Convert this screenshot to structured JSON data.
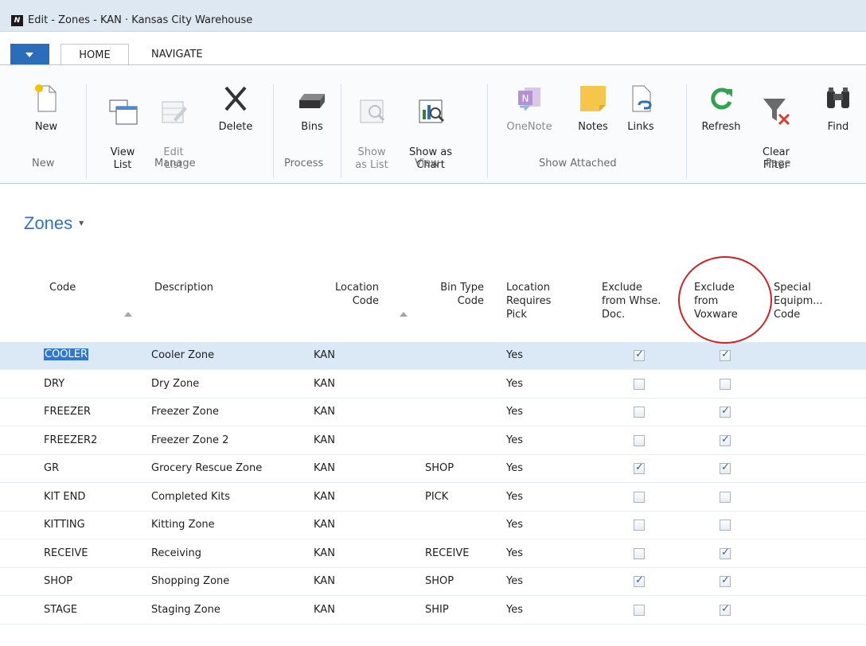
{
  "window": {
    "title": "Edit - Zones - KAN · Kansas City Warehouse",
    "logo": "dynamics-nav-logo"
  },
  "tabs": [
    {
      "label": "HOME",
      "active": true
    },
    {
      "label": "NAVIGATE",
      "active": false
    }
  ],
  "ribbon": {
    "buttons": {
      "new": {
        "label": "New",
        "icon": "new-document-icon"
      },
      "view_list": {
        "label": "View\nList",
        "icon": "view-list-icon"
      },
      "edit_list": {
        "label": "Edit\nList",
        "icon": "edit-list-icon",
        "disabled": true
      },
      "delete": {
        "label": "Delete",
        "icon": "delete-x-icon"
      },
      "bins": {
        "label": "Bins",
        "icon": "bins-icon"
      },
      "show_as_list": {
        "label": "Show\nas List",
        "icon": "show-as-list-icon",
        "disabled": true
      },
      "show_as_chart": {
        "label": "Show as\nChart",
        "icon": "show-as-chart-icon"
      },
      "onenote": {
        "label": "OneNote",
        "icon": "onenote-icon",
        "disabled": true
      },
      "notes": {
        "label": "Notes",
        "icon": "notes-icon"
      },
      "links": {
        "label": "Links",
        "icon": "links-icon"
      },
      "refresh": {
        "label": "Refresh",
        "icon": "refresh-icon"
      },
      "clear_filter": {
        "label": "Clear\nFilter",
        "icon": "clear-filter-icon"
      },
      "find": {
        "label": "Find",
        "icon": "binoculars-icon"
      }
    },
    "groups": {
      "new": "New",
      "manage": "Manage",
      "process": "Process",
      "view": "View",
      "show_attached": "Show Attached",
      "page": "Page"
    }
  },
  "page": {
    "title": "Zones",
    "caret": "▾"
  },
  "table": {
    "columns": {
      "code": "Code",
      "description": "Description",
      "location_code": "Location\nCode",
      "bin_type_code": "Bin Type\nCode",
      "location_requires_pick": "Location\nRequires\nPick",
      "exclude_whse": "Exclude\nfrom Whse.\nDoc.",
      "exclude_voxware": "Exclude\nfrom\nVoxware",
      "special_equipment": "Special\nEquipm...\nCode"
    },
    "rows": [
      {
        "code": "COOLER",
        "description": "Cooler Zone",
        "location": "KAN",
        "bin_type": "",
        "requires_pick": "Yes",
        "excl_whse": true,
        "excl_vox": true
      },
      {
        "code": "DRY",
        "description": "Dry Zone",
        "location": "KAN",
        "bin_type": "",
        "requires_pick": "Yes",
        "excl_whse": false,
        "excl_vox": false
      },
      {
        "code": "FREEZER",
        "description": "Freezer Zone",
        "location": "KAN",
        "bin_type": "",
        "requires_pick": "Yes",
        "excl_whse": false,
        "excl_vox": true
      },
      {
        "code": "FREEZER2",
        "description": "Freezer Zone 2",
        "location": "KAN",
        "bin_type": "",
        "requires_pick": "Yes",
        "excl_whse": false,
        "excl_vox": true
      },
      {
        "code": "GR",
        "description": "Grocery Rescue Zone",
        "location": "KAN",
        "bin_type": "SHOP",
        "requires_pick": "Yes",
        "excl_whse": true,
        "excl_vox": true
      },
      {
        "code": "KIT END",
        "description": "Completed Kits",
        "location": "KAN",
        "bin_type": "PICK",
        "requires_pick": "Yes",
        "excl_whse": false,
        "excl_vox": false
      },
      {
        "code": "KITTING",
        "description": "Kitting Zone",
        "location": "KAN",
        "bin_type": "",
        "requires_pick": "Yes",
        "excl_whse": false,
        "excl_vox": false
      },
      {
        "code": "RECEIVE",
        "description": "Receiving",
        "location": "KAN",
        "bin_type": "RECEIVE",
        "requires_pick": "Yes",
        "excl_whse": false,
        "excl_vox": true
      },
      {
        "code": "SHOP",
        "description": "Shopping Zone",
        "location": "KAN",
        "bin_type": "SHOP",
        "requires_pick": "Yes",
        "excl_whse": true,
        "excl_vox": true
      },
      {
        "code": "STAGE",
        "description": "Staging Zone",
        "location": "KAN",
        "bin_type": "SHIP",
        "requires_pick": "Yes",
        "excl_whse": false,
        "excl_vox": true
      }
    ]
  },
  "colors": {
    "accent": "#2a73c5",
    "menu_button": "#2a6ebb",
    "selection": "#dbe8f6",
    "highlight": "#cc2222"
  }
}
